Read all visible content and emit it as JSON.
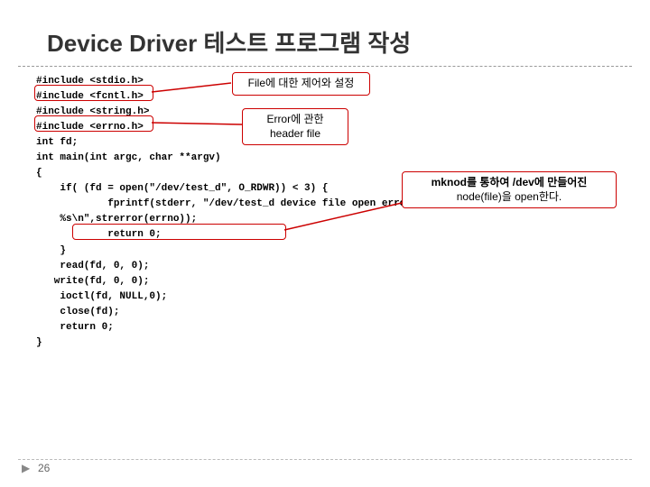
{
  "title": "Device Driver 테스트 프로그램 작성",
  "code": {
    "inc1": "#include <stdio.h>",
    "inc2": "#include <fcntl.h>",
    "inc3": "#include <string.h>",
    "inc4": "#include <errno.h>",
    "blank1": "",
    "fd": "int fd;",
    "blank2": "",
    "main": "int main(int argc, char **argv)",
    "brace_open": "{",
    "blank3": "",
    "if_line": "    if( (fd = open(\"/dev/test_d\", O_RDWR)) < 3) {",
    "fprintf": "            fprintf(stderr, \"/dev/test_d device file open error!! ..",
    "cont": "    %s\\n\",strerror(errno));",
    "ret0a": "            return 0;",
    "close_if": "    }",
    "read": "    read(fd, 0, 0);",
    "write": "   write(fd, 0, 0);",
    "ioctl": "    ioctl(fd, NULL,0);",
    "close": "    close(fd);",
    "ret0b": "    return 0;",
    "brace_close": "}"
  },
  "callouts": {
    "file": "File에 대한 제어와 설정",
    "error_l1": "Error에 관한",
    "error_l2": "header file",
    "mknod_l1": "mknod를 통하여 /dev에 만들어진",
    "mknod_l2": "node(file)을 open한다."
  },
  "page": "26"
}
